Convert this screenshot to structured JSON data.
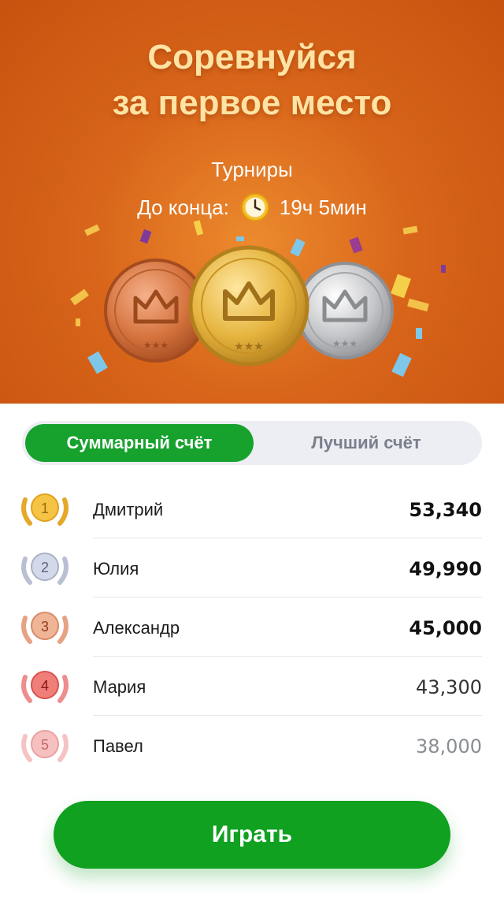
{
  "hero": {
    "title_line1": "Соревнуйся",
    "title_line2": "за первое место",
    "section": "Турниры",
    "countdown_label": "До конца:",
    "countdown_icon": "clock-icon",
    "countdown_value": "19ч 5мин",
    "medals": [
      "bronze-crown-medal",
      "gold-crown-medal",
      "silver-crown-medal"
    ]
  },
  "tabs": {
    "active": "Суммарный счёт",
    "inactive": "Лучший счёт"
  },
  "leaderboard": [
    {
      "rank": "1",
      "name": "Дмитрий",
      "score": "53,340",
      "badge": "gold-laurel-badge"
    },
    {
      "rank": "2",
      "name": "Юлия",
      "score": "49,990",
      "badge": "silver-laurel-badge"
    },
    {
      "rank": "3",
      "name": "Александр",
      "score": "45,000",
      "badge": "bronze-laurel-badge"
    },
    {
      "rank": "4",
      "name": "Мария",
      "score": "43,300",
      "badge": "red-laurel-badge"
    },
    {
      "rank": "5",
      "name": "Павел",
      "score": "38,000",
      "badge": "pink-laurel-badge"
    }
  ],
  "play_button": "Играть",
  "colors": {
    "accent_green": "#17a22e",
    "hero_orange": "#d8651a",
    "title_gold": "#ffe3a3"
  }
}
